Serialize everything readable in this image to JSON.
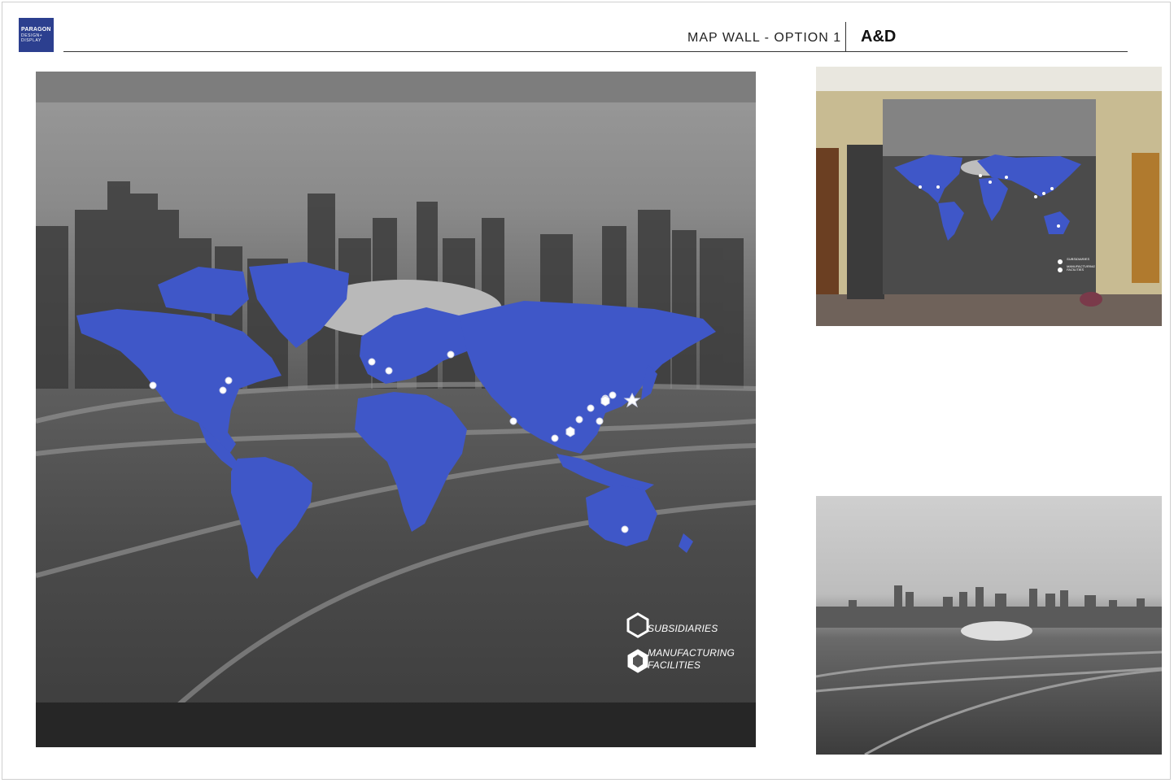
{
  "header": {
    "logo_line1": "PARAGON",
    "logo_line2": "DESIGN+",
    "logo_line3": "DISPLAY",
    "page_title": "MAP WALL - OPTION 1",
    "section_tag": "A&D"
  },
  "main_render": {
    "legend": {
      "subsidiaries_label": "SUBSIDIARIES",
      "manufacturing_label_line1": "MANUFACTURING",
      "manufacturing_label_line2": "FACILITIES"
    },
    "colors": {
      "map_fill": "#3f57c8",
      "marker": "#ffffff"
    }
  },
  "installed_photo": {
    "legend": {
      "subsidiaries_label": "SUBSIDIARIES",
      "manufacturing_label": "MANUFACTURING FACILITIES"
    }
  }
}
